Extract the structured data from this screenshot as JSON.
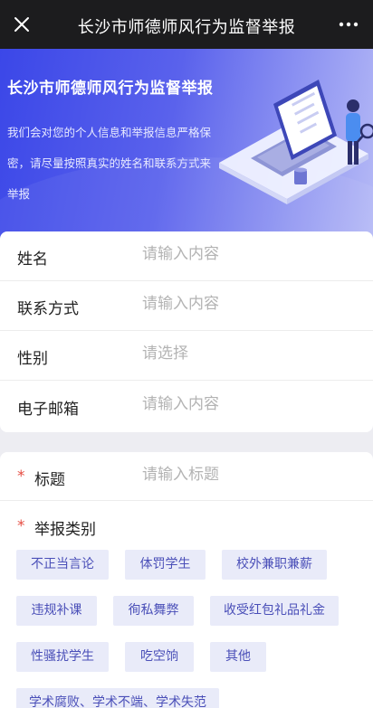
{
  "topbar": {
    "title": "长沙市师德师风行为监督举报",
    "close_icon": "close-icon",
    "more_icon": "more-icon"
  },
  "banner": {
    "heading": "长沙市师德师风行为监督举报",
    "description": "我们会对您的个人信息和举报信息严格保密，请尽量按照真实的姓名和联系方式来举报"
  },
  "form": {
    "fields": [
      {
        "label": "姓名",
        "placeholder": "请输入内容"
      },
      {
        "label": "联系方式",
        "placeholder": "请输入内容"
      },
      {
        "label": "性别",
        "placeholder": "请选择"
      },
      {
        "label": "电子邮箱",
        "placeholder": "请输入内容"
      }
    ],
    "title_field": {
      "required_mark": "*",
      "label": "标题",
      "placeholder": "请输入标题"
    },
    "category": {
      "required_mark": "*",
      "label": "举报类别",
      "tags": [
        "不正当言论",
        "体罚学生",
        "校外兼职兼薪",
        "违规补课",
        "徇私舞弊",
        "收受红包礼品礼金",
        "性骚扰学生",
        "吃空饷",
        "其他",
        "学术腐败、学术不端、学术失范"
      ]
    }
  },
  "colors": {
    "banner_start": "#3b47e8",
    "tag_bg": "#e9ebf9",
    "tag_text": "#4a4fb8",
    "required": "#e54d42"
  }
}
